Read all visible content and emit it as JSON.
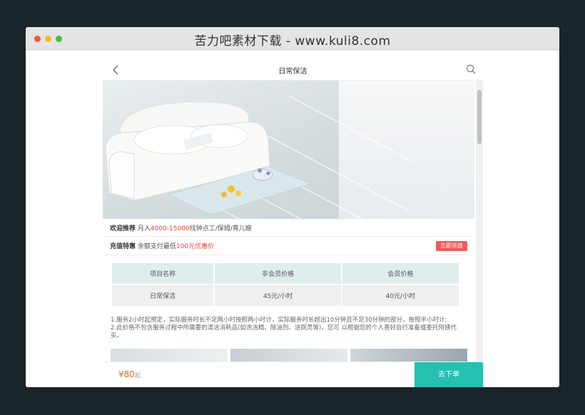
{
  "browser": {
    "title": "苦力吧素材下载 - www.kuli8.com"
  },
  "page": {
    "title": "日常保洁"
  },
  "promo": {
    "welcome_label": "欢迎推荐",
    "welcome_prefix": "月入",
    "welcome_amount": "4000-15000",
    "welcome_suffix": "找钟点工/保姆/育儿嫂",
    "recharge_label": "充值特惠",
    "recharge_prefix": "余额支付最低",
    "recharge_amount": "100元优惠价",
    "recharge_button": "立即充值"
  },
  "table": {
    "headers": [
      "项目名称",
      "非会员价格",
      "会员价格"
    ],
    "rows": [
      [
        "日常保洁",
        "45元/小时",
        "40元/小时"
      ]
    ]
  },
  "notes": [
    "1.服务2小时起预定，实际服务时长不足两小时按照两小时计，实际服务时长超出10分钟且不足30分钟的部分，按照半小时计;",
    "2.此价格不包含服务过程中所需要的清洁消耗品(如洗洁精、除油剂、洁厕灵等)，您可 以根据您的个人喜好自行准备或委托阿姨代买。"
  ],
  "footer": {
    "price": "¥80",
    "price_suffix": "起",
    "order_button": "去下单"
  },
  "icons": {
    "back": "chevron-left-icon",
    "search": "search-icon"
  },
  "colors": {
    "accent": "#25c0b0",
    "price": "#e06a2b",
    "highlight": "#e0463a",
    "recharge": "#ef5b5b"
  }
}
